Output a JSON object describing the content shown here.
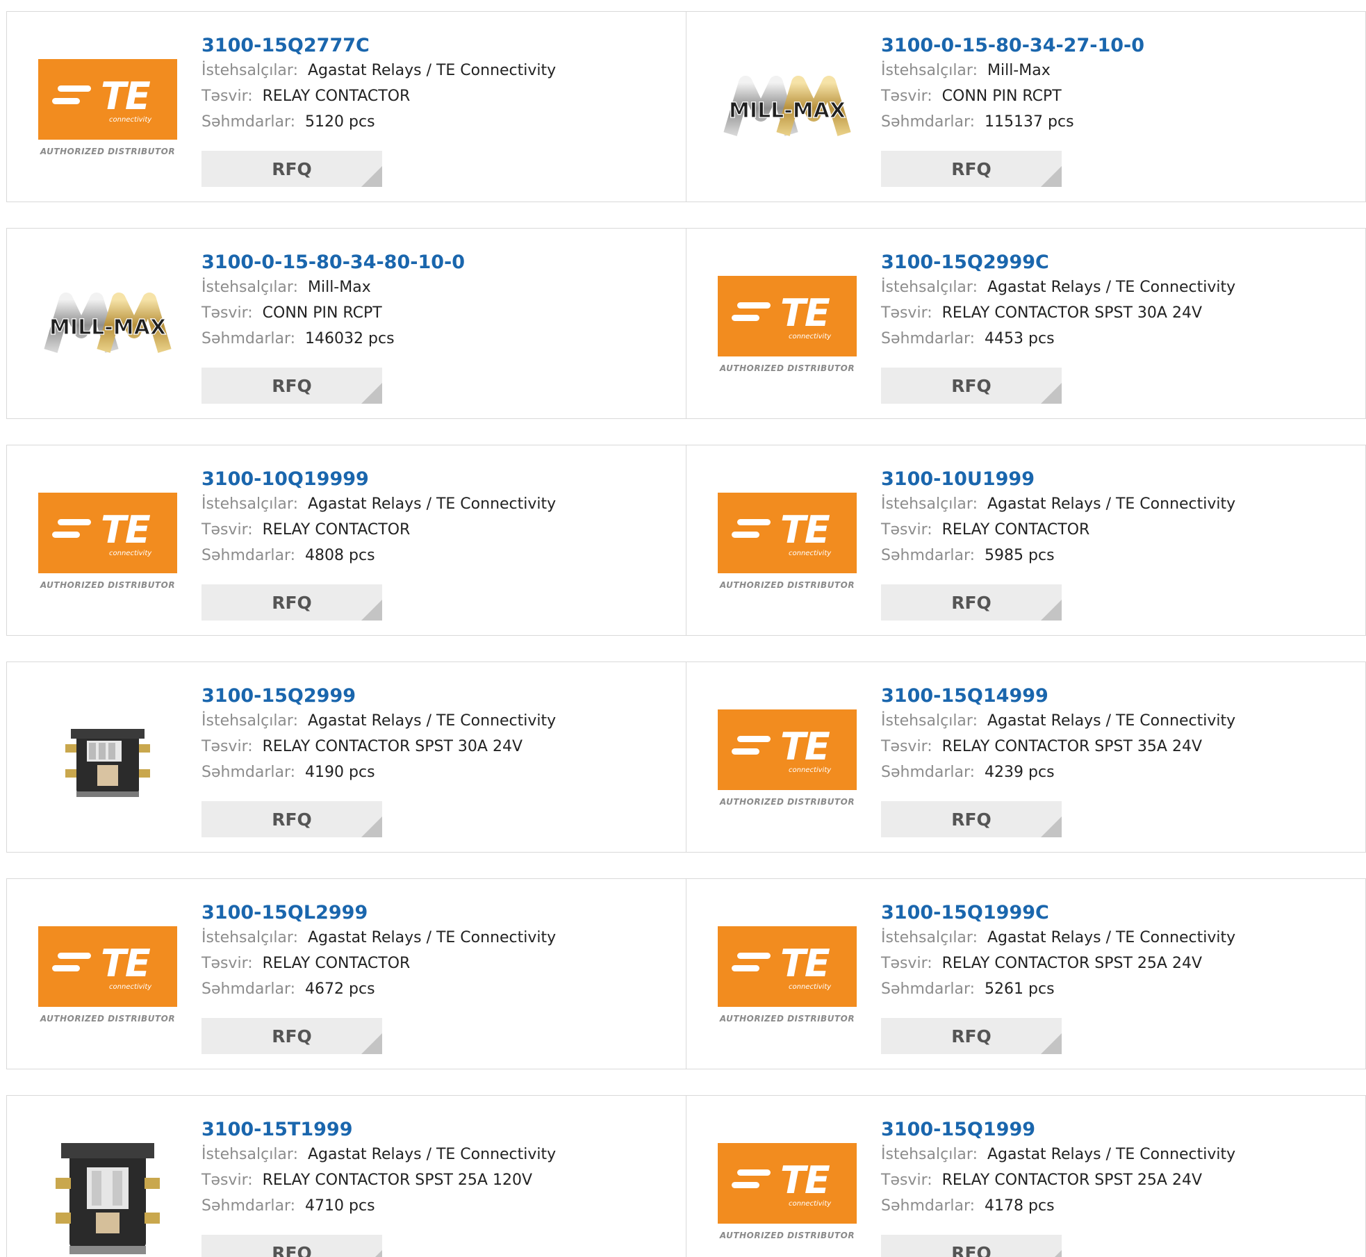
{
  "labels": {
    "manufacturer": "İstehsalçılar:",
    "description": "Təsvir:",
    "stock": "Səhmdarlar:",
    "rfq": "RFQ"
  },
  "logos": {
    "te_letters": "TE",
    "te_sub": "connectivity",
    "te_caption": "AUTHORIZED DISTRIBUTOR",
    "millmax_text": "MILL-MAX"
  },
  "colors": {
    "part_link": "#1a66ad",
    "te_orange": "#f28c1f",
    "rfq_bg": "#ececec"
  },
  "products": [
    {
      "part": "3100-15Q2777C",
      "manufacturer": "Agastat Relays / TE Connectivity",
      "description": "RELAY CONTACTOR",
      "stock": "5120 pcs",
      "image": "te-logo"
    },
    {
      "part": "3100-0-15-80-34-27-10-0",
      "manufacturer": "Mill-Max",
      "description": "CONN PIN RCPT",
      "stock": "115137 pcs",
      "image": "millmax-logo"
    },
    {
      "part": "3100-0-15-80-34-80-10-0",
      "manufacturer": "Mill-Max",
      "description": "CONN PIN RCPT",
      "stock": "146032 pcs",
      "image": "millmax-logo"
    },
    {
      "part": "3100-15Q2999C",
      "manufacturer": "Agastat Relays / TE Connectivity",
      "description": "RELAY CONTACTOR SPST 30A 24V",
      "stock": "4453 pcs",
      "image": "te-logo"
    },
    {
      "part": "3100-10Q19999",
      "manufacturer": "Agastat Relays / TE Connectivity",
      "description": "RELAY CONTACTOR",
      "stock": "4808 pcs",
      "image": "te-logo"
    },
    {
      "part": "3100-10U1999",
      "manufacturer": "Agastat Relays / TE Connectivity",
      "description": "RELAY CONTACTOR",
      "stock": "5985 pcs",
      "image": "te-logo"
    },
    {
      "part": "3100-15Q2999",
      "manufacturer": "Agastat Relays / TE Connectivity",
      "description": "RELAY CONTACTOR SPST 30A 24V",
      "stock": "4190 pcs",
      "image": "contactor-photo"
    },
    {
      "part": "3100-15Q14999",
      "manufacturer": "Agastat Relays / TE Connectivity",
      "description": "RELAY CONTACTOR SPST 35A 24V",
      "stock": "4239 pcs",
      "image": "te-logo"
    },
    {
      "part": "3100-15QL2999",
      "manufacturer": "Agastat Relays / TE Connectivity",
      "description": "RELAY CONTACTOR",
      "stock": "4672 pcs",
      "image": "te-logo"
    },
    {
      "part": "3100-15Q1999C",
      "manufacturer": "Agastat Relays / TE Connectivity",
      "description": "RELAY CONTACTOR SPST 25A 24V",
      "stock": "5261 pcs",
      "image": "te-logo"
    },
    {
      "part": "3100-15T1999",
      "manufacturer": "Agastat Relays / TE Connectivity",
      "description": "RELAY CONTACTOR SPST 25A 120V",
      "stock": "4710 pcs",
      "image": "contactor-photo-large"
    },
    {
      "part": "3100-15Q1999",
      "manufacturer": "Agastat Relays / TE Connectivity",
      "description": "RELAY CONTACTOR SPST 25A 24V",
      "stock": "4178 pcs",
      "image": "te-logo"
    }
  ]
}
